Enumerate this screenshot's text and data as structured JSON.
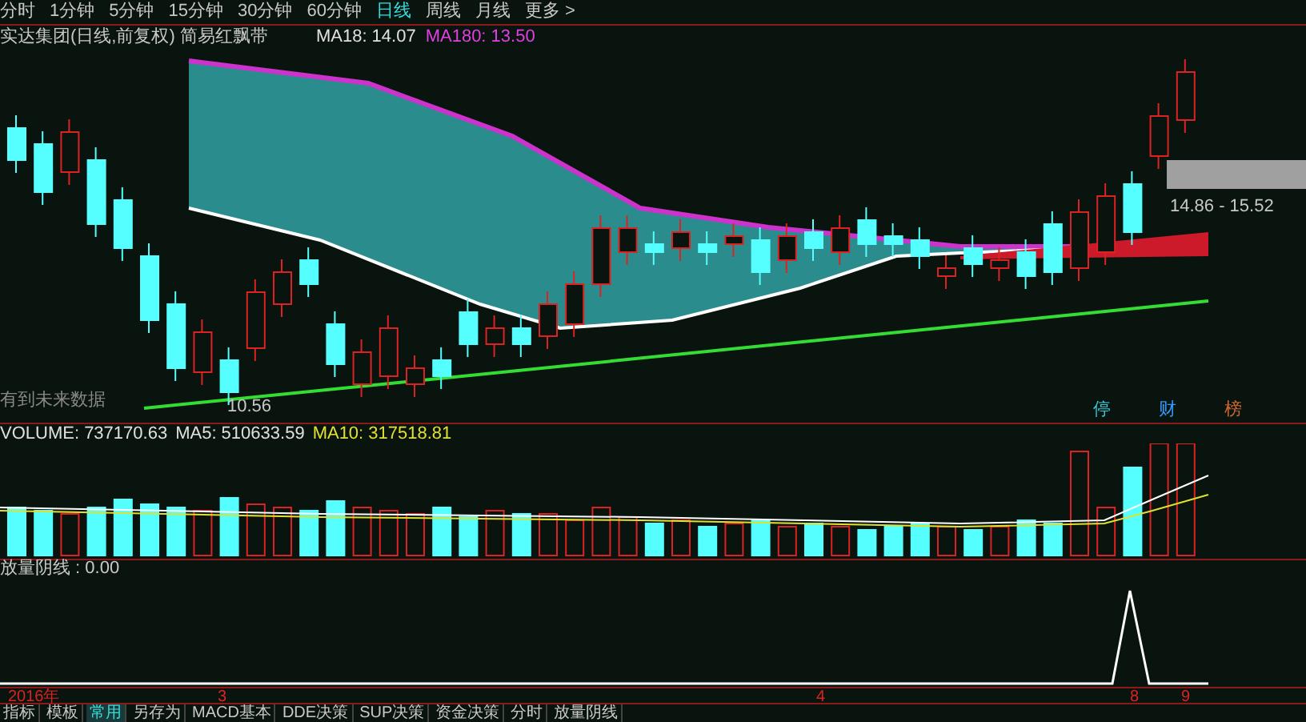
{
  "periods": [
    {
      "label": "分时",
      "selected": false
    },
    {
      "label": "1分钟",
      "selected": false
    },
    {
      "label": "5分钟",
      "selected": false
    },
    {
      "label": "15分钟",
      "selected": false
    },
    {
      "label": "30分钟",
      "selected": false
    },
    {
      "label": "60分钟",
      "selected": false
    },
    {
      "label": "日线",
      "selected": true
    },
    {
      "label": "周线",
      "selected": false
    },
    {
      "label": "月线",
      "selected": false
    },
    {
      "label": "更多 >",
      "selected": false
    }
  ],
  "title": {
    "stock": "实达集团(日线,前复权) 简易红飘带",
    "ma18": "MA18: 14.07",
    "ma180": "MA180: 13.50"
  },
  "main": {
    "low_label": "10.56",
    "range_label": "14.86 - 15.52",
    "future_note": "有到未来数据",
    "markers": [
      {
        "text": "停",
        "color": "#33ccdd"
      },
      {
        "text": "财",
        "color": "#3399ff"
      },
      {
        "text": "榜",
        "color": "#cc6633"
      }
    ]
  },
  "volume": {
    "volume": "VOLUME: 737170.63",
    "ma5": "MA5: 510633.59",
    "ma10": "MA10: 317518.81"
  },
  "indicator": {
    "label": "放量阴线 : 0.00"
  },
  "axis": {
    "labels": [
      "2016年",
      "3",
      "4",
      "8",
      "9"
    ]
  },
  "tabs": [
    {
      "label": "指标",
      "selected": false
    },
    {
      "label": "模板",
      "selected": false
    },
    {
      "label": "常用",
      "selected": true
    },
    {
      "label": "另存为",
      "selected": false
    },
    {
      "label": "MACD基本",
      "selected": false
    },
    {
      "label": "DDE决策",
      "selected": false
    },
    {
      "label": "SUP决策",
      "selected": false
    },
    {
      "label": "资金决策",
      "selected": false
    },
    {
      "label": "分时",
      "selected": false
    },
    {
      "label": "放量阴线",
      "selected": false
    }
  ]
}
